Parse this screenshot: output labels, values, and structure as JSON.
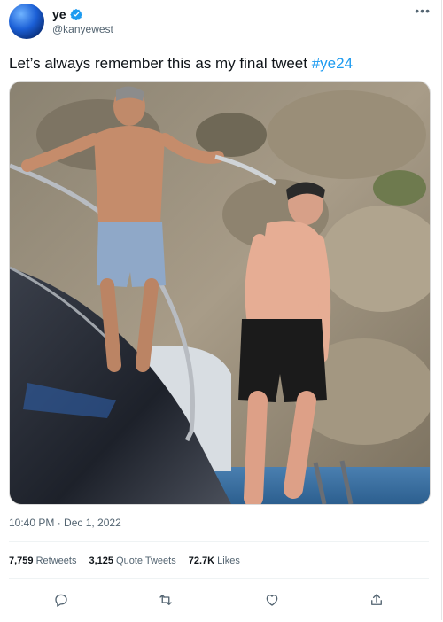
{
  "author": {
    "name": "ye",
    "handle": "@kanyewest",
    "verified": true
  },
  "tweet": {
    "text": "Let’s always remember this as my final tweet",
    "hashtag": "#ye24",
    "timestamp": "10:40 PM · Dec 1, 2022"
  },
  "stats": {
    "retweets_count": "7,759",
    "retweets_label": "Retweets",
    "quotes_count": "3,125",
    "quotes_label": "Quote Tweets",
    "likes_count": "72.7K",
    "likes_label": "Likes"
  },
  "icons": {
    "more": "more-horizontal-icon",
    "reply": "reply-icon",
    "retweet": "retweet-icon",
    "like": "heart-icon",
    "share": "share-icon"
  },
  "colors": {
    "accent": "#1d9bf0",
    "muted": "#536471"
  }
}
